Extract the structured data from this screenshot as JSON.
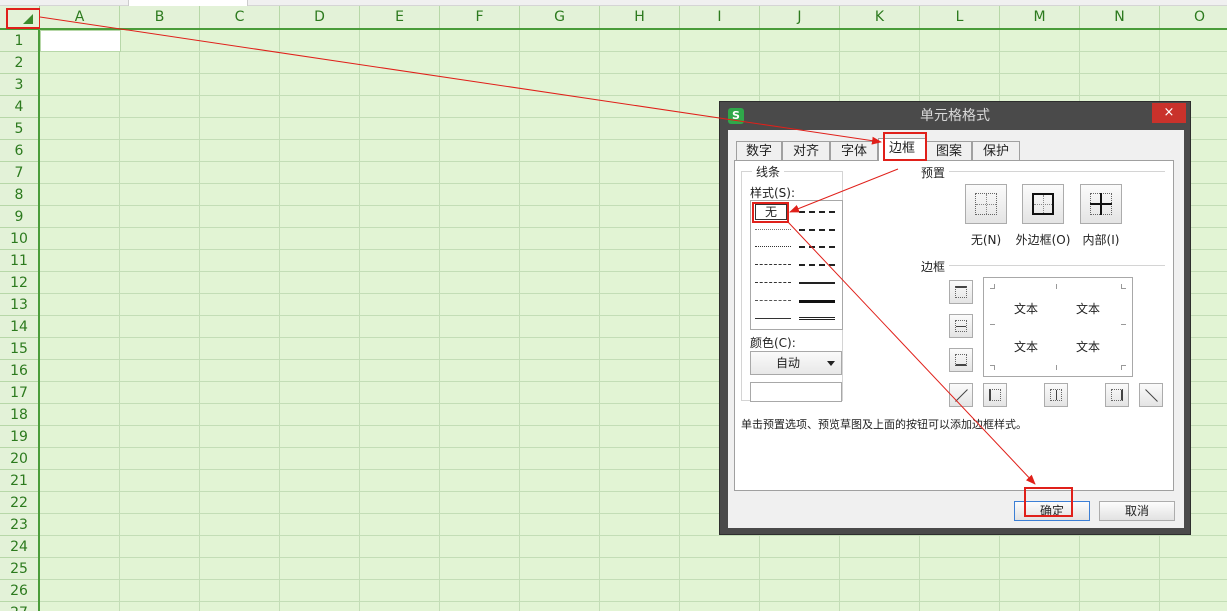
{
  "spreadsheet": {
    "columns": [
      "A",
      "B",
      "C",
      "D",
      "E",
      "F",
      "G",
      "H",
      "I",
      "J",
      "K",
      "L",
      "M",
      "N",
      "O"
    ],
    "rows": [
      "1",
      "2",
      "3",
      "4",
      "5",
      "6",
      "7",
      "8",
      "9",
      "10",
      "11",
      "12",
      "13",
      "14",
      "15",
      "16",
      "17",
      "18",
      "19",
      "20",
      "21",
      "22",
      "23",
      "24",
      "25",
      "26",
      "27"
    ]
  },
  "dialog": {
    "app_icon": "S",
    "title": "单元格格式",
    "close": "×",
    "tabs": [
      "数字",
      "对齐",
      "字体",
      "边框",
      "图案",
      "保护"
    ],
    "active_tab": "边框",
    "line_group": {
      "label": "线条",
      "style_label": "样式(S):",
      "style_none": "无",
      "color_label": "颜色(C):",
      "color_value": "自动"
    },
    "presets": {
      "label": "预置",
      "items": [
        {
          "label": "无(N)",
          "icon": "preset-none-icon"
        },
        {
          "label": "外边框(O)",
          "icon": "preset-outline-icon"
        },
        {
          "label": "内部(I)",
          "icon": "preset-inside-icon"
        }
      ]
    },
    "border": {
      "label": "边框",
      "preview_text": [
        "文本",
        "文本",
        "文本",
        "文本"
      ]
    },
    "hint": "单击预置选项、预览草图及上面的按钮可以添加边框样式。",
    "ok": "确定",
    "cancel": "取消"
  },
  "colors": {
    "sheet_bg": "#e2f4d4",
    "header_text": "#2c7a1e",
    "highlight": "#e0201a",
    "dialog_frame": "#4a4a4a",
    "close_red": "#c9322b"
  }
}
